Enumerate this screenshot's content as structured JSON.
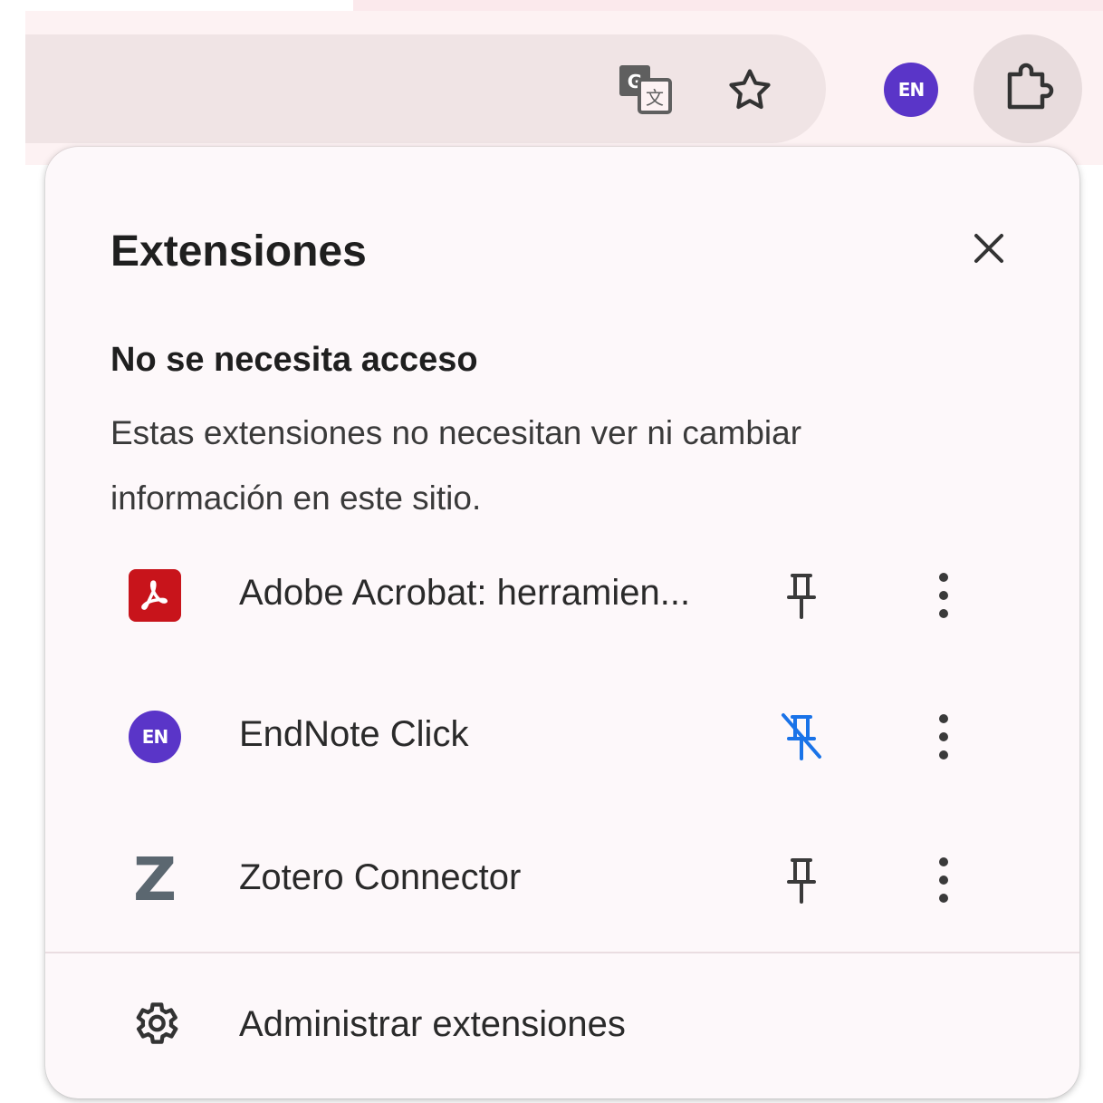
{
  "toolbar": {
    "icons": [
      "translate-icon",
      "star-icon",
      "endnote-extension-icon",
      "extensions-puzzle-icon"
    ],
    "endnote_badge": "EN"
  },
  "panel": {
    "title": "Extensiones",
    "close_icon": "close-icon",
    "section": {
      "heading": "No se necesita acceso",
      "description": "Estas extensiones no necesitan ver ni cambiar información en este sitio."
    },
    "extensions": [
      {
        "name": "Adobe Acrobat: herramien...",
        "icon": "adobe-acrobat-icon",
        "pinned": false
      },
      {
        "name": "EndNote Click",
        "icon": "endnote-icon",
        "badge": "EN",
        "pinned": true,
        "pin_color": "#1a73e8"
      },
      {
        "name": "Zotero Connector",
        "icon": "zotero-icon",
        "badge": "Z",
        "pinned": false
      }
    ],
    "manage_label": "Administrar extensiones"
  }
}
